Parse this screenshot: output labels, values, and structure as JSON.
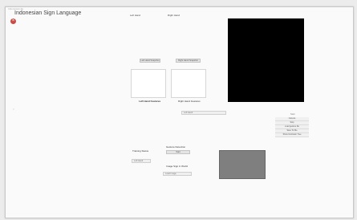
{
  "window": {
    "caption": "Indonesian-SL",
    "title": "Indonesian Sign Language"
  },
  "hands": {
    "left_label": "Left Hand",
    "right_label": "Right Hand",
    "left_button": "Left Hand Snapshot",
    "right_button": "Right Hand Snapshot",
    "left_features_label": "Left Hand Features",
    "right_features_label": "Right Hand Features"
  },
  "controls": {
    "select_value": "Left Hand",
    "marker": "<"
  },
  "menu": {
    "header": "Start",
    "items": [
      "Camera",
      "Stop",
      "Load gesture file",
      "Save To File",
      "Show Confusion Tree"
    ]
  },
  "classify": {
    "training_label": "Training Status",
    "training_value": "Left Hand",
    "gesture_label": "Gesture Detection",
    "detect_button": "Start",
    "image_label": "Image Sign in World",
    "image_value": "Load Image"
  },
  "colors": {
    "close": "#c84b44",
    "camera": "#000000",
    "gesture": "#7f7f7f"
  }
}
